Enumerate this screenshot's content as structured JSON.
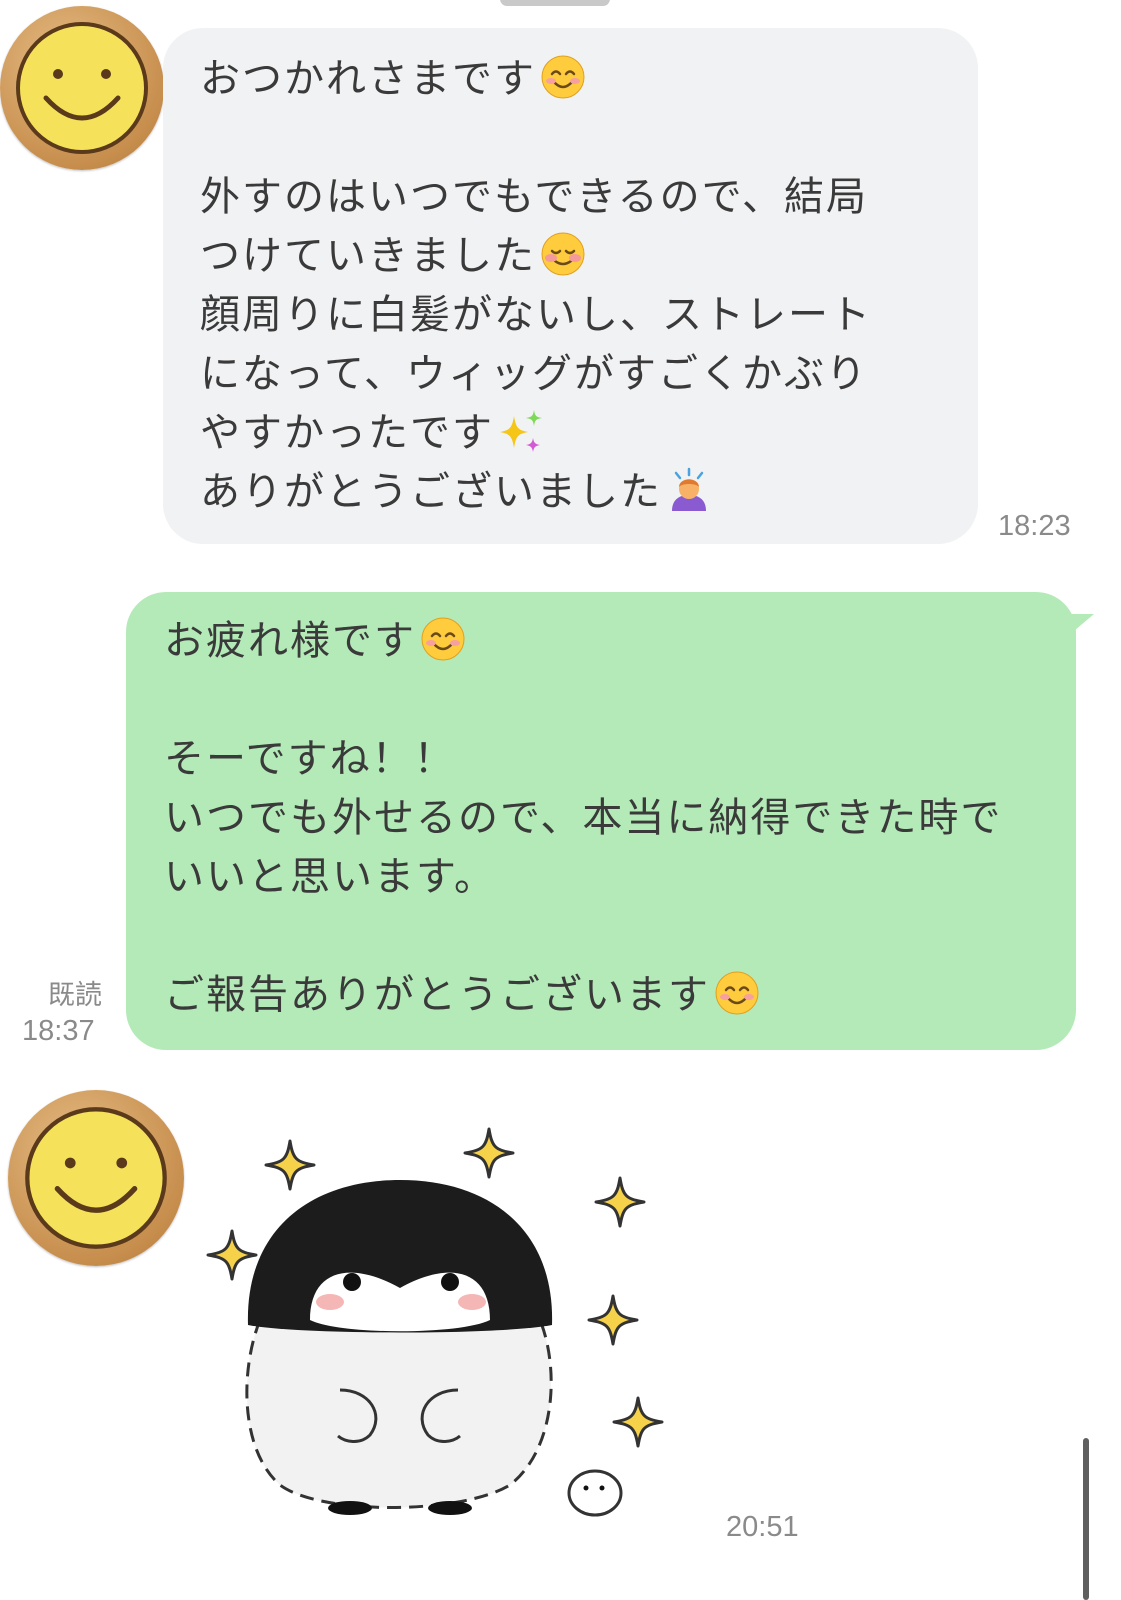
{
  "messages": [
    {
      "sender": "other",
      "lines": [
        {
          "text": "おつかれさまです",
          "emoji": "smiling-face"
        },
        {
          "text": ""
        },
        {
          "text": "外すのはいつでもできるので、結局"
        },
        {
          "text": "つけていきました",
          "emoji": "blushing-face"
        },
        {
          "text": "顔周りに白髪がないし、ストレート"
        },
        {
          "text": "になって、ウィッグがすごくかぶり"
        },
        {
          "text": "やすかったです",
          "emoji": "sparkles"
        },
        {
          "text": "ありがとうございました",
          "emoji": "person-bowing"
        }
      ],
      "time": "18:23"
    },
    {
      "sender": "me",
      "lines": [
        {
          "text": "お疲れ様です",
          "emoji": "smiling-face"
        },
        {
          "text": ""
        },
        {
          "text": "そーですね！！"
        },
        {
          "text": "いつでも外せるので、本当に納得できた時で"
        },
        {
          "text": "いいと思います。"
        },
        {
          "text": ""
        },
        {
          "text": "ご報告ありがとうございます",
          "emoji": "smiling-face"
        }
      ],
      "read_label": "既読",
      "time": "18:37"
    },
    {
      "sender": "other",
      "sticker": "penguin-sparkle-sticker",
      "time": "20:51"
    }
  ],
  "colors": {
    "incoming_bubble": "#f1f2f4",
    "outgoing_bubble": "#b4eab8",
    "timestamp": "#8a8a8a"
  }
}
